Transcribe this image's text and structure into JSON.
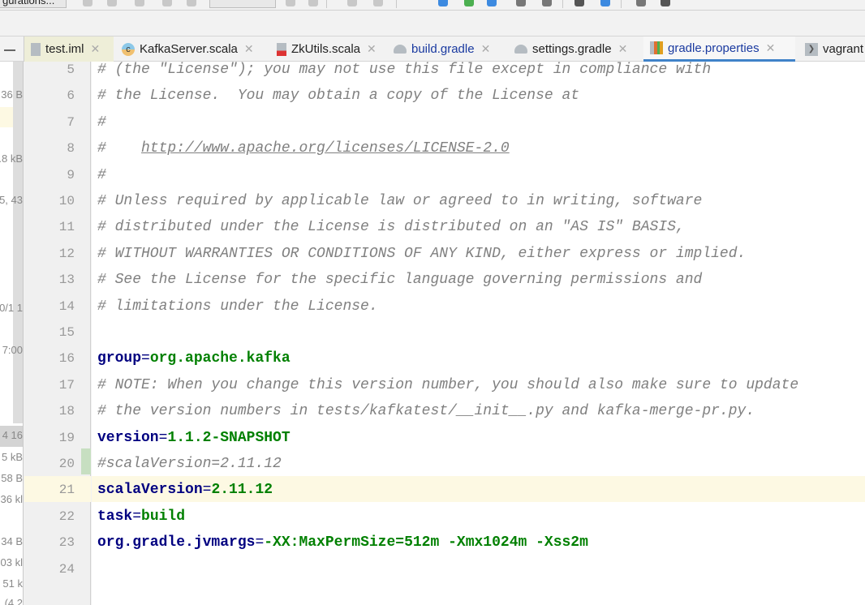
{
  "toolbar": {
    "run_config_label": "gurations..."
  },
  "tabs": [
    {
      "label": "test.iml",
      "icon": "iml-file-icon",
      "active": false
    },
    {
      "label": "KafkaServer.scala",
      "icon": "scala-class-icon",
      "active": false
    },
    {
      "label": "ZkUtils.scala",
      "icon": "scala-file-icon",
      "active": false
    },
    {
      "label": "build.gradle",
      "icon": "gradle-elephant-icon",
      "active": false
    },
    {
      "label": "settings.gradle",
      "icon": "gradle-elephant-icon",
      "active": false
    },
    {
      "label": "gradle.properties",
      "icon": "properties-file-icon",
      "active": true
    },
    {
      "label": "vagrant",
      "icon": "terminal-file-icon",
      "active": false
    }
  ],
  "left_panel": [
    "36 B",
    ".8 kB",
    "5, 43",
    "0/1 1",
    "7:00",
    "4 16",
    "5 kB",
    "58 B",
    "36 kl",
    "34 B",
    "03 kl",
    "51 k",
    "(4.2"
  ],
  "editor": {
    "accent": "#4083c9",
    "current_line": 21,
    "lines": [
      {
        "n": "5",
        "type": "comment",
        "text": "# (the \"License\"); you may not use this file except in compliance with"
      },
      {
        "n": "6",
        "type": "comment",
        "text": "# the License.  You may obtain a copy of the License at"
      },
      {
        "n": "7",
        "type": "comment",
        "text": "#"
      },
      {
        "n": "8",
        "type": "comment-link",
        "prefix": "#    ",
        "link": "http://www.apache.org/licenses/LICENSE-2.0"
      },
      {
        "n": "9",
        "type": "comment",
        "text": "#"
      },
      {
        "n": "10",
        "type": "comment",
        "text": "# Unless required by applicable law or agreed to in writing, software"
      },
      {
        "n": "11",
        "type": "comment",
        "text": "# distributed under the License is distributed on an \"AS IS\" BASIS,"
      },
      {
        "n": "12",
        "type": "comment",
        "text": "# WITHOUT WARRANTIES OR CONDITIONS OF ANY KIND, either express or implied."
      },
      {
        "n": "13",
        "type": "comment",
        "text": "# See the License for the specific language governing permissions and"
      },
      {
        "n": "14",
        "type": "comment",
        "text": "# limitations under the License."
      },
      {
        "n": "15",
        "type": "blank",
        "text": ""
      },
      {
        "n": "16",
        "type": "prop",
        "key": "group",
        "eq": "=",
        "value": "org.apache.kafka"
      },
      {
        "n": "17",
        "type": "comment",
        "text": "# NOTE: When you change this version number, you should also make sure to update"
      },
      {
        "n": "18",
        "type": "comment",
        "text": "# the version numbers in tests/kafkatest/__init__.py and kafka-merge-pr.py."
      },
      {
        "n": "19",
        "type": "prop",
        "key": "version",
        "eq": "=",
        "value": "1.1.2-SNAPSHOT"
      },
      {
        "n": "20",
        "type": "comment",
        "text": "#scalaVersion=2.11.12"
      },
      {
        "n": "21",
        "type": "prop",
        "key": "scalaVersion",
        "eq": "=",
        "value": "2.11.12"
      },
      {
        "n": "22",
        "type": "prop",
        "key": "task",
        "eq": "=",
        "value": "build"
      },
      {
        "n": "23",
        "type": "prop",
        "key": "org.gradle.jvmargs",
        "eq": "=",
        "value": "-XX:MaxPermSize=512m -Xmx1024m -Xss2m"
      },
      {
        "n": "24",
        "type": "blank",
        "text": ""
      }
    ]
  }
}
